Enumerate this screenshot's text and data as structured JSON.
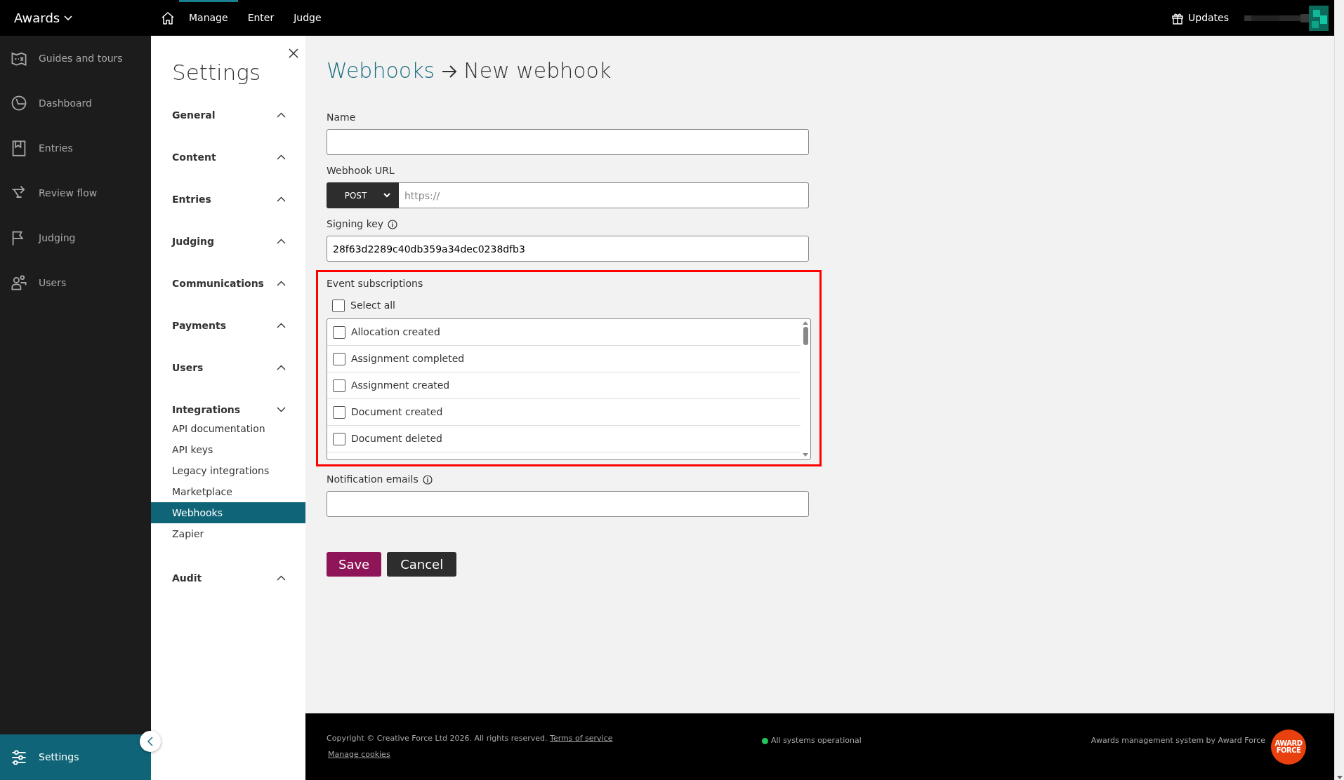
{
  "top_bar": {
    "brand": "Awards",
    "nav": [
      {
        "label": "Manage",
        "selected": true
      },
      {
        "label": "Enter",
        "selected": false
      },
      {
        "label": "Judge",
        "selected": false
      }
    ],
    "updates": "Updates"
  },
  "sidebar": {
    "items": [
      {
        "label": "Guides and tours",
        "selected": false
      },
      {
        "label": "Dashboard",
        "selected": false
      },
      {
        "label": "Entries",
        "selected": false
      },
      {
        "label": "Review flow",
        "selected": false
      },
      {
        "label": "Judging",
        "selected": false
      },
      {
        "label": "Users",
        "selected": false
      },
      {
        "label": "Settings",
        "selected": true
      }
    ]
  },
  "settings_panel": {
    "title": "Settings",
    "sections": [
      {
        "label": "General",
        "expanded": false
      },
      {
        "label": "Content",
        "expanded": false
      },
      {
        "label": "Entries",
        "expanded": false
      },
      {
        "label": "Judging",
        "expanded": false
      },
      {
        "label": "Communications",
        "expanded": false
      },
      {
        "label": "Payments",
        "expanded": false
      },
      {
        "label": "Users",
        "expanded": false
      },
      {
        "label": "Integrations",
        "expanded": true,
        "children": [
          {
            "label": "API documentation",
            "selected": false
          },
          {
            "label": "API keys",
            "selected": false
          },
          {
            "label": "Legacy integrations",
            "selected": false
          },
          {
            "label": "Marketplace",
            "selected": false
          },
          {
            "label": "Webhooks",
            "selected": true
          },
          {
            "label": "Zapier",
            "selected": false
          }
        ]
      },
      {
        "label": "Audit",
        "expanded": false
      }
    ]
  },
  "page": {
    "breadcrumb": "Webhooks",
    "title": "New webhook",
    "name_field": {
      "label": "Name"
    },
    "url_field": {
      "label": "Webhook URL",
      "method": "POST",
      "placeholder": "https://"
    },
    "signing_key": {
      "label": "Signing key",
      "value": "28f63d2289c40db359a34dec0238dfb3"
    },
    "event_subscriptions": {
      "label": "Event subscriptions",
      "highlighted": true,
      "select_all": {
        "label": "Select all",
        "checked": false
      },
      "events": [
        {
          "label": "Allocation created",
          "checked": false
        },
        {
          "label": "Assignment completed",
          "checked": false
        },
        {
          "label": "Assignment created",
          "checked": false
        },
        {
          "label": "Document created",
          "checked": false
        },
        {
          "label": "Document deleted",
          "checked": false
        }
      ]
    },
    "notification_emails": {
      "label": "Notification emails"
    },
    "buttons": [
      {
        "label": "Save",
        "kind": "primary"
      },
      {
        "label": "Cancel",
        "kind": "secondary"
      }
    ]
  },
  "footer": {
    "copyright": "Copyright © Creative Force Ltd 2026. All rights reserved.",
    "terms_link": "Terms of service",
    "cookies_link": "Manage cookies",
    "status": {
      "label": "All systems operational",
      "color": "#22c55e"
    },
    "credit": "Awards management system by Award Force",
    "logo_lines": [
      "AWARD",
      "FORCE"
    ]
  }
}
